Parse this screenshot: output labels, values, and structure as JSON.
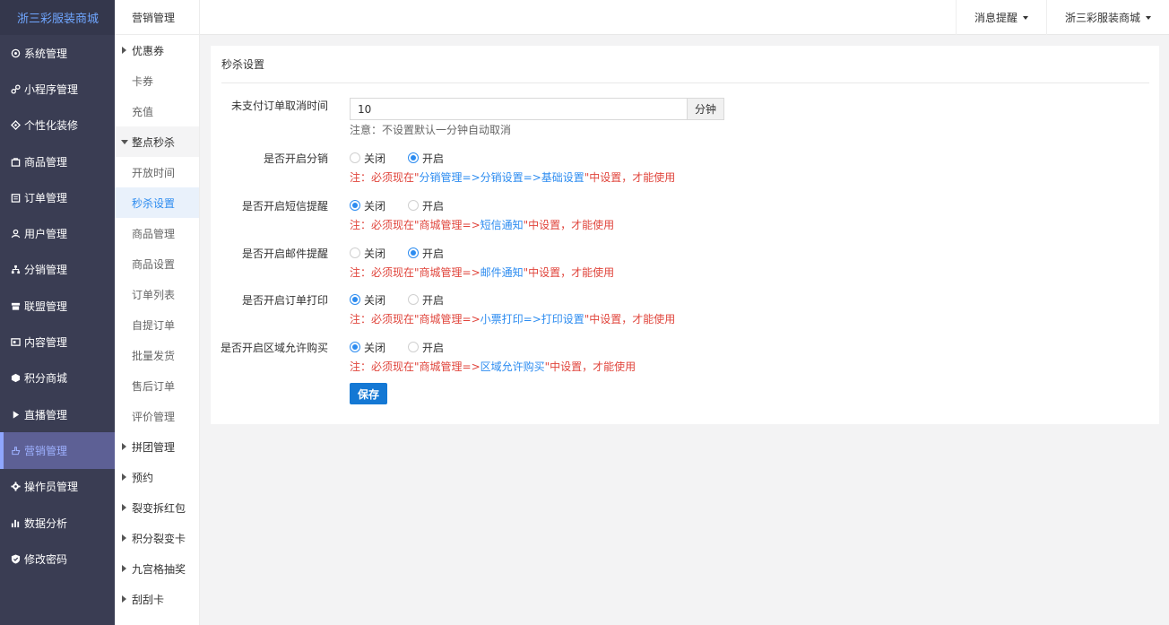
{
  "brand": "浙三彩服装商城",
  "sidebar": {
    "items": [
      {
        "label": "系统管理",
        "icon": "gear-outline-icon"
      },
      {
        "label": "小程序管理",
        "icon": "miniprogram-icon"
      },
      {
        "label": "个性化装修",
        "icon": "paint-icon"
      },
      {
        "label": "商品管理",
        "icon": "bag-icon"
      },
      {
        "label": "订单管理",
        "icon": "calendar-icon"
      },
      {
        "label": "用户管理",
        "icon": "user-icon"
      },
      {
        "label": "分销管理",
        "icon": "network-icon"
      },
      {
        "label": "联盟管理",
        "icon": "store-icon"
      },
      {
        "label": "内容管理",
        "icon": "content-icon"
      },
      {
        "label": "积分商城",
        "icon": "cube-icon"
      },
      {
        "label": "直播管理",
        "icon": "play-icon"
      },
      {
        "label": "营销管理",
        "icon": "hand-icon"
      },
      {
        "label": "操作员管理",
        "icon": "gear-icon"
      },
      {
        "label": "数据分析",
        "icon": "bar-chart-icon"
      },
      {
        "label": "修改密码",
        "icon": "shield-icon"
      }
    ]
  },
  "subnav": {
    "title": "营销管理",
    "items": [
      {
        "label": "优惠券",
        "type": "group"
      },
      {
        "label": "卡券",
        "type": "child"
      },
      {
        "label": "充值",
        "type": "child"
      },
      {
        "label": "整点秒杀",
        "type": "group-open"
      },
      {
        "label": "开放时间",
        "type": "child"
      },
      {
        "label": "秒杀设置",
        "type": "selected"
      },
      {
        "label": "商品管理",
        "type": "child"
      },
      {
        "label": "商品设置",
        "type": "child"
      },
      {
        "label": "订单列表",
        "type": "child"
      },
      {
        "label": "自提订单",
        "type": "child"
      },
      {
        "label": "批量发货",
        "type": "child"
      },
      {
        "label": "售后订单",
        "type": "child"
      },
      {
        "label": "评价管理",
        "type": "child"
      },
      {
        "label": "拼团管理",
        "type": "group"
      },
      {
        "label": "预约",
        "type": "group"
      },
      {
        "label": "裂变拆红包",
        "type": "group"
      },
      {
        "label": "积分裂变卡",
        "type": "group"
      },
      {
        "label": "九宫格抽奖",
        "type": "group"
      },
      {
        "label": "刮刮卡",
        "type": "group"
      }
    ]
  },
  "topbar": {
    "messages": "消息提醒",
    "account": "浙三彩服装商城"
  },
  "form": {
    "card_title": "秒杀设置",
    "cancel_time": {
      "label": "未支付订单取消时间",
      "value": "10",
      "unit": "分钟",
      "hint": "注意：不设置默认一分钟自动取消"
    },
    "radio_off": "关闭",
    "radio_on": "开启",
    "rows": [
      {
        "label": "是否开启分销",
        "selected": "on",
        "note_pre": "注：必须现在\"",
        "note_link": "分销管理=>分销设置=>基础设置",
        "note_post": "\"中设置，才能使用"
      },
      {
        "label": "是否开启短信提醒",
        "selected": "off",
        "note_pre": "注：必须现在\"商城管理=>",
        "note_link": "短信通知",
        "note_post": "\"中设置，才能使用"
      },
      {
        "label": "是否开启邮件提醒",
        "selected": "on",
        "note_pre": "注：必须现在\"商城管理=>",
        "note_link": "邮件通知",
        "note_post": "\"中设置，才能使用"
      },
      {
        "label": "是否开启订单打印",
        "selected": "off",
        "note_pre": "注：必须现在\"商城管理=>",
        "note_link": "小票打印=>打印设置",
        "note_post": "\"中设置，才能使用"
      },
      {
        "label": "是否开启区域允许购买",
        "selected": "off",
        "note_pre": "注：必须现在\"商城管理=>",
        "note_link": "区域允许购买",
        "note_post": "\"中设置，才能使用"
      }
    ],
    "save": "保存"
  },
  "colors": {
    "sidebar_bg": "#3a3d53",
    "active_bg": "#5d6095",
    "accent": "#2d8cf0",
    "note_red": "#e0453c",
    "save_btn": "#1478d4"
  }
}
